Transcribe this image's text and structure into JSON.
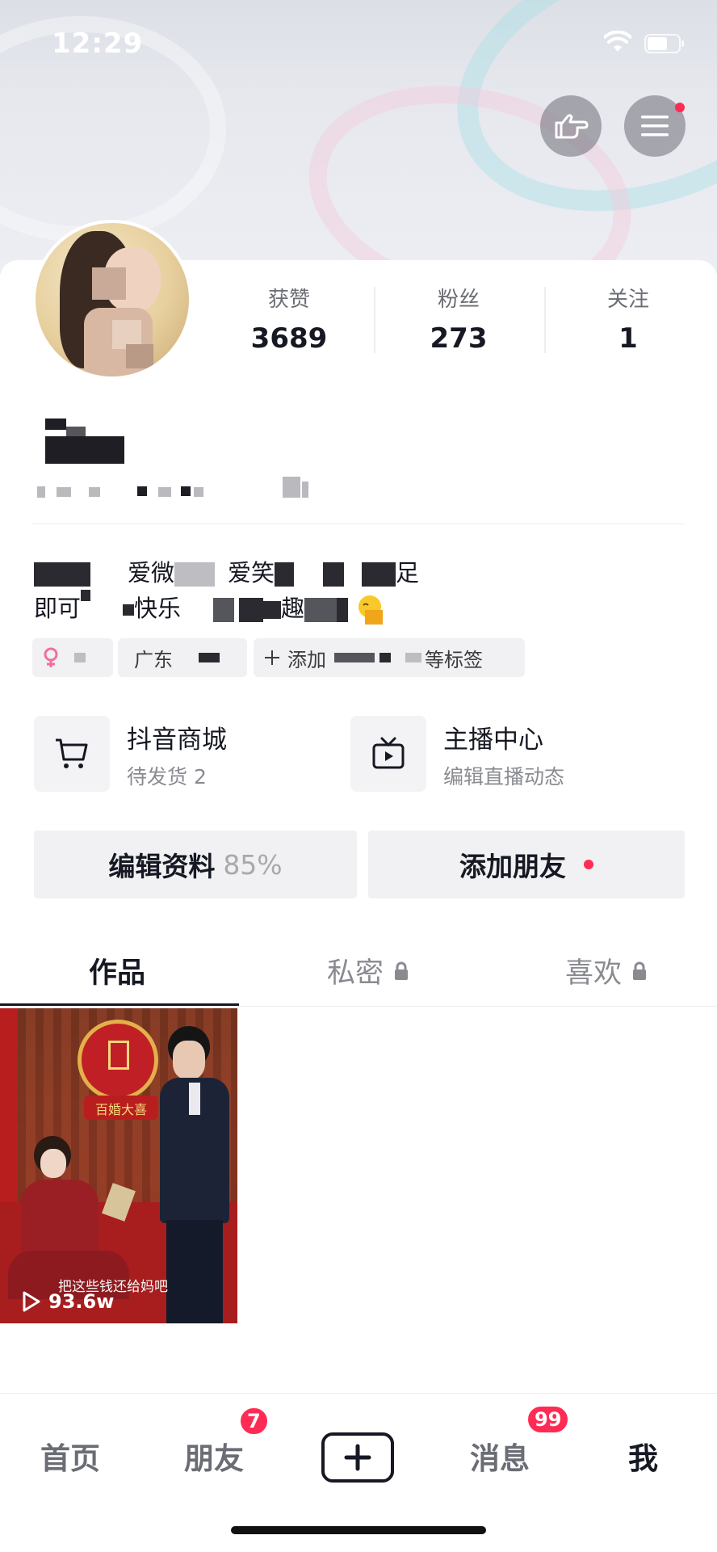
{
  "status_bar": {
    "time": "12:29"
  },
  "profile": {
    "stats": [
      {
        "label": "获赞",
        "value": "3689"
      },
      {
        "label": "粉丝",
        "value": "273"
      },
      {
        "label": "关注",
        "value": "1"
      }
    ],
    "bio": {
      "line1_parts": [
        "爱微",
        "爱笑",
        "足"
      ],
      "line2_parts": [
        "即可",
        "快乐",
        "趣"
      ]
    },
    "tags": {
      "location": "广东",
      "add_tags_prefix": "添加",
      "add_tags_suffix": "等标签"
    }
  },
  "features": [
    {
      "title": "抖音商城",
      "subtitle": "待发货 2",
      "icon": "cart-icon"
    },
    {
      "title": "主播中心",
      "subtitle": "编辑直播动态",
      "icon": "tv-icon"
    }
  ],
  "actions": {
    "edit_profile": "编辑资料",
    "edit_percent": "85%",
    "add_friends": "添加朋友"
  },
  "tabs": [
    {
      "label": "作品",
      "active": true
    },
    {
      "label": "私密",
      "locked": true
    },
    {
      "label": "喜欢",
      "locked": true
    }
  ],
  "video": {
    "caption": "把这些钱还给妈吧",
    "plays": "93.6w",
    "sign_text": "百婚大喜"
  },
  "bottom_nav": {
    "home": "首页",
    "friends": "朋友",
    "friends_badge": "7",
    "messages": "消息",
    "messages_badge": "99",
    "me": "我"
  },
  "colors": {
    "accent": "#fe2c55",
    "text": "#161823",
    "muted": "#8a8b91"
  }
}
